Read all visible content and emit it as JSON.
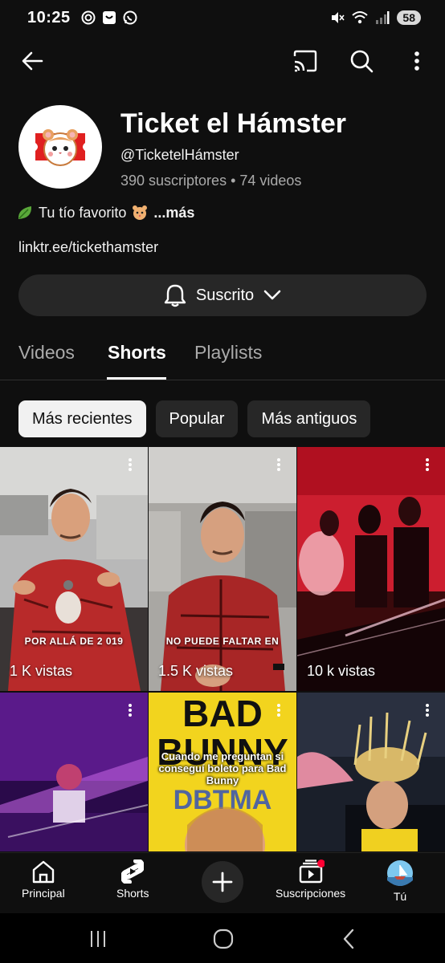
{
  "status_bar": {
    "time": "10:25",
    "battery": "58"
  },
  "channel": {
    "name": "Ticket el Hámster",
    "handle": "@TicketelHámster",
    "stats": "390 suscriptores • 74 videos",
    "description": "Tu tío favorito",
    "more_label": "...más",
    "link": "linktr.ee/tickethamster"
  },
  "subscribe": {
    "label": "Suscrito"
  },
  "tabs": [
    {
      "label": "Videos"
    },
    {
      "label": "Shorts"
    },
    {
      "label": "Playlists"
    }
  ],
  "chips": [
    {
      "label": "Más recientes"
    },
    {
      "label": "Popular"
    },
    {
      "label": "Más antiguos"
    }
  ],
  "shorts": [
    {
      "views": "1 K vistas",
      "caption": "POR ALLÁ DE 2 019"
    },
    {
      "views": "1.5 K vistas",
      "caption": "NO PUEDE FALTAR EN"
    },
    {
      "views": "10 k vistas",
      "caption": ""
    },
    {
      "views": "",
      "caption": ""
    },
    {
      "views": "",
      "caption": "",
      "title_big": "BAD BUNNY",
      "overlay": "Cuando me preguntan si conseguí boleto para Bad Bunny"
    },
    {
      "views": "",
      "caption": ""
    }
  ],
  "bottom_nav": [
    {
      "label": "Principal",
      "icon": "home-icon"
    },
    {
      "label": "Shorts",
      "icon": "shorts-icon"
    },
    {
      "label": "Suscripciones",
      "icon": "subscriptions-icon"
    },
    {
      "label": "Tú",
      "icon": "avatar-icon"
    }
  ],
  "colors": {
    "background": "#0f0f0f",
    "surface": "#272727",
    "accent": "#ff0033"
  }
}
